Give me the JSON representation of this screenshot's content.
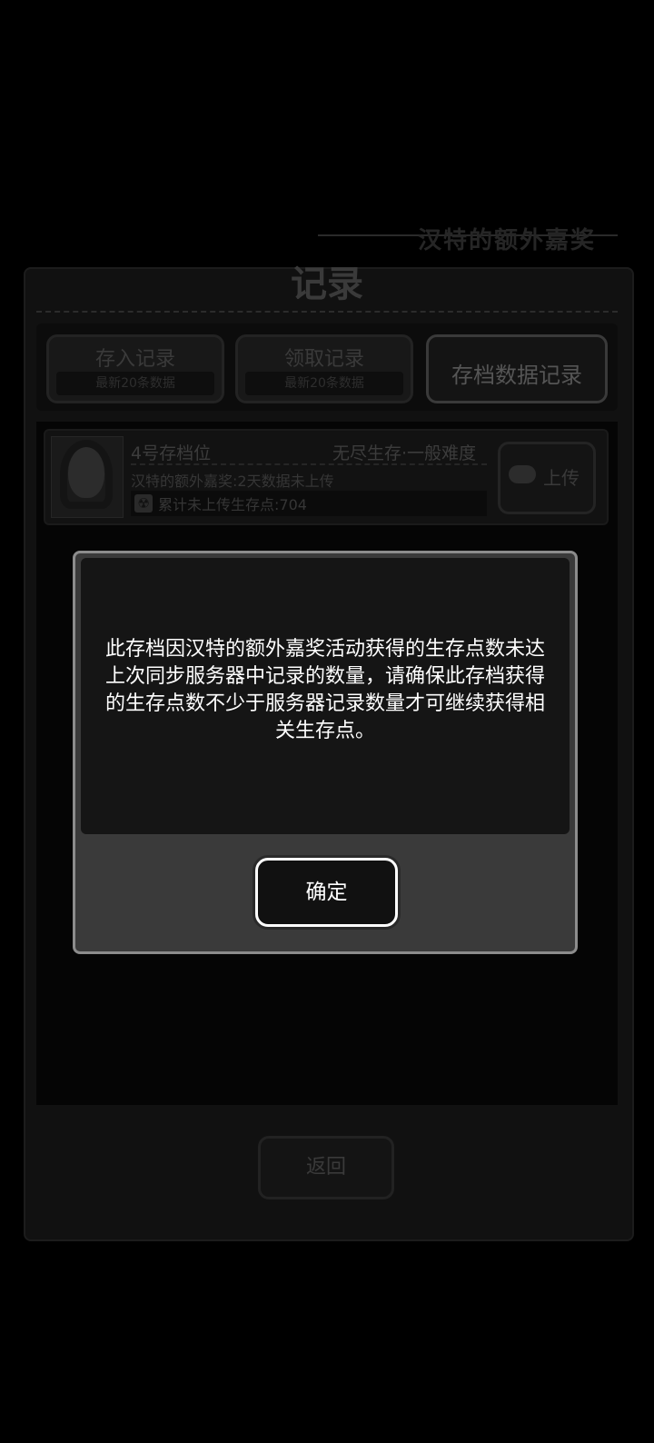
{
  "background": {
    "banner_text": "汉特的额外嘉奖"
  },
  "panel": {
    "title": "记录",
    "tabs": [
      {
        "label": "存入记录",
        "sub": "最新20条数据"
      },
      {
        "label": "领取记录",
        "sub": "最新20条数据"
      },
      {
        "label": "存档数据记录"
      }
    ],
    "record": {
      "slot": "4号存档位",
      "mode": "无尽生存·一般难度",
      "line2": "汉特的额外嘉奖:2天数据未上传",
      "line3": "累计未上传生存点:704",
      "upload_label": "上传",
      "icons": {
        "avatar": "character-portrait",
        "radiation": "radiation-icon",
        "cloud": "cloud-upload-icon"
      }
    },
    "back_label": "返回"
  },
  "dialog": {
    "message": "此存档因汉特的额外嘉奖活动获得的生存点数未达上次同步服务器中记录的数量，请确保此存档获得的生存点数不少于服务器记录数量才可继续获得相关生存点。",
    "ok_label": "确定"
  }
}
